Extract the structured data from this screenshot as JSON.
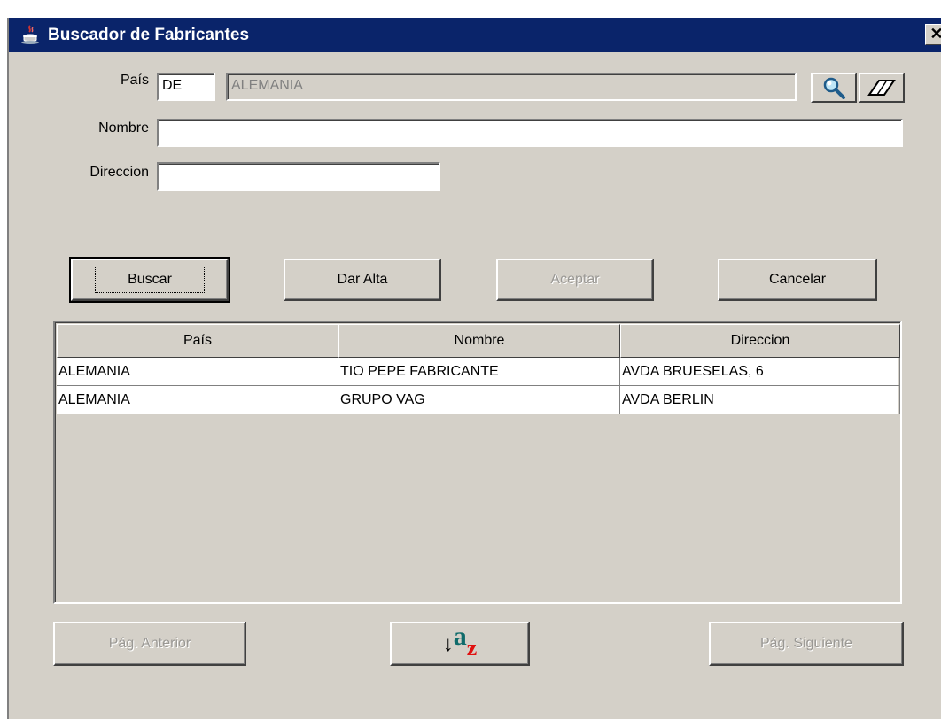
{
  "window": {
    "title": "Buscador de Fabricantes",
    "close_label": "✕"
  },
  "form": {
    "pais_label": "País",
    "pais_code": "DE",
    "pais_name": "ALEMANIA",
    "nombre_label": "Nombre",
    "nombre_value": "",
    "direccion_label": "Direccion",
    "direccion_value": ""
  },
  "buttons": {
    "buscar": "Buscar",
    "dar_alta": "Dar Alta",
    "aceptar": "Aceptar",
    "cancelar": "Cancelar",
    "pag_anterior": "Pág. Anterior",
    "pag_siguiente": "Pág. Siguiente"
  },
  "sort_icon": {
    "arrow": "↓",
    "a": "a",
    "z": "z"
  },
  "icons": [
    "search-icon",
    "eraser-icon",
    "sort-az-icon",
    "java-icon"
  ],
  "table": {
    "columns": [
      "País",
      "Nombre",
      "Direccion"
    ],
    "rows": [
      [
        "ALEMANIA",
        "TIO PEPE FABRICANTE",
        "AVDA BRUESELAS, 6"
      ],
      [
        "ALEMANIA",
        "GRUPO VAG",
        "AVDA BERLIN"
      ]
    ]
  }
}
